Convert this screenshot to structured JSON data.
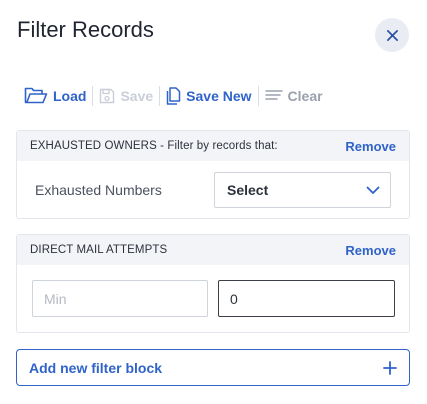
{
  "header": {
    "title": "Filter Records"
  },
  "toolbar": {
    "load_label": "Load",
    "save_label": "Save",
    "save_new_label": "Save New",
    "clear_label": "Clear"
  },
  "blocks": [
    {
      "title": "EXHAUSTED OWNERS  - Filter by records that:",
      "remove_label": "Remove",
      "field_label": "Exhausted Numbers",
      "select_value": "Select"
    },
    {
      "title": "DIRECT MAIL ATTEMPTS",
      "remove_label": "Remove",
      "min_placeholder": "Min",
      "max_value": "0"
    }
  ],
  "add_block_label": "Add new filter block",
  "colors": {
    "accent": "#2f63c9",
    "disabled": "#c9ced8",
    "header_bg": "#f3f4f7"
  },
  "icons": [
    "close-icon",
    "folder-open-icon",
    "save-icon",
    "document-icon",
    "clear-lines-icon",
    "chevron-down-icon",
    "plus-icon"
  ]
}
